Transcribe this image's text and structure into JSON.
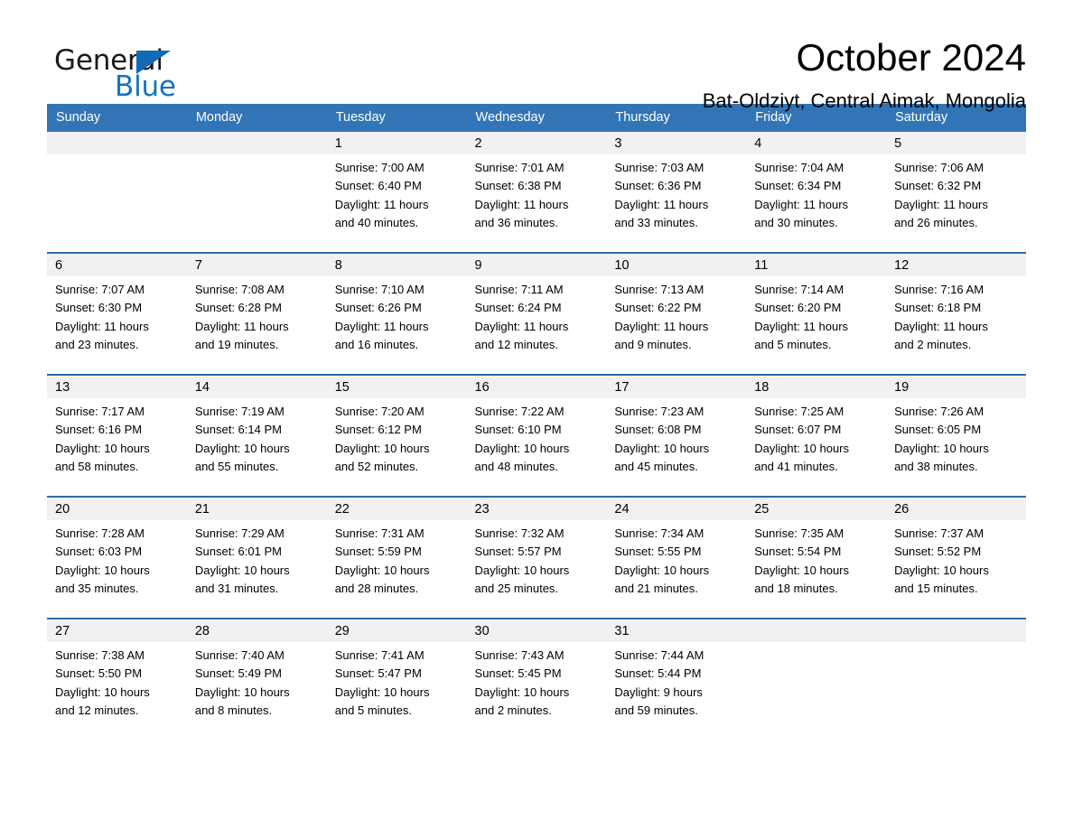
{
  "logo": {
    "word_one": "General",
    "word_two": "Blue",
    "triangle_color": "#106ab4",
    "blue_text_color": "#1673bd"
  },
  "header": {
    "month_title": "October 2024",
    "location": "Bat-Oldziyt, Central Aimak, Mongolia"
  },
  "theme": {
    "header_blue": "#3275b6",
    "row_border_blue": "#2d6da6",
    "daynum_band_gray": "#f1f1f1"
  },
  "weekday_headers": [
    "Sunday",
    "Monday",
    "Tuesday",
    "Wednesday",
    "Thursday",
    "Friday",
    "Saturday"
  ],
  "weeks": [
    [
      {
        "day": "",
        "lines": []
      },
      {
        "day": "",
        "lines": []
      },
      {
        "day": "1",
        "lines": [
          "Sunrise: 7:00 AM",
          "Sunset: 6:40 PM",
          "Daylight: 11 hours",
          "and 40 minutes."
        ]
      },
      {
        "day": "2",
        "lines": [
          "Sunrise: 7:01 AM",
          "Sunset: 6:38 PM",
          "Daylight: 11 hours",
          "and 36 minutes."
        ]
      },
      {
        "day": "3",
        "lines": [
          "Sunrise: 7:03 AM",
          "Sunset: 6:36 PM",
          "Daylight: 11 hours",
          "and 33 minutes."
        ]
      },
      {
        "day": "4",
        "lines": [
          "Sunrise: 7:04 AM",
          "Sunset: 6:34 PM",
          "Daylight: 11 hours",
          "and 30 minutes."
        ]
      },
      {
        "day": "5",
        "lines": [
          "Sunrise: 7:06 AM",
          "Sunset: 6:32 PM",
          "Daylight: 11 hours",
          "and 26 minutes."
        ]
      }
    ],
    [
      {
        "day": "6",
        "lines": [
          "Sunrise: 7:07 AM",
          "Sunset: 6:30 PM",
          "Daylight: 11 hours",
          "and 23 minutes."
        ]
      },
      {
        "day": "7",
        "lines": [
          "Sunrise: 7:08 AM",
          "Sunset: 6:28 PM",
          "Daylight: 11 hours",
          "and 19 minutes."
        ]
      },
      {
        "day": "8",
        "lines": [
          "Sunrise: 7:10 AM",
          "Sunset: 6:26 PM",
          "Daylight: 11 hours",
          "and 16 minutes."
        ]
      },
      {
        "day": "9",
        "lines": [
          "Sunrise: 7:11 AM",
          "Sunset: 6:24 PM",
          "Daylight: 11 hours",
          "and 12 minutes."
        ]
      },
      {
        "day": "10",
        "lines": [
          "Sunrise: 7:13 AM",
          "Sunset: 6:22 PM",
          "Daylight: 11 hours",
          "and 9 minutes."
        ]
      },
      {
        "day": "11",
        "lines": [
          "Sunrise: 7:14 AM",
          "Sunset: 6:20 PM",
          "Daylight: 11 hours",
          "and 5 minutes."
        ]
      },
      {
        "day": "12",
        "lines": [
          "Sunrise: 7:16 AM",
          "Sunset: 6:18 PM",
          "Daylight: 11 hours",
          "and 2 minutes."
        ]
      }
    ],
    [
      {
        "day": "13",
        "lines": [
          "Sunrise: 7:17 AM",
          "Sunset: 6:16 PM",
          "Daylight: 10 hours",
          "and 58 minutes."
        ]
      },
      {
        "day": "14",
        "lines": [
          "Sunrise: 7:19 AM",
          "Sunset: 6:14 PM",
          "Daylight: 10 hours",
          "and 55 minutes."
        ]
      },
      {
        "day": "15",
        "lines": [
          "Sunrise: 7:20 AM",
          "Sunset: 6:12 PM",
          "Daylight: 10 hours",
          "and 52 minutes."
        ]
      },
      {
        "day": "16",
        "lines": [
          "Sunrise: 7:22 AM",
          "Sunset: 6:10 PM",
          "Daylight: 10 hours",
          "and 48 minutes."
        ]
      },
      {
        "day": "17",
        "lines": [
          "Sunrise: 7:23 AM",
          "Sunset: 6:08 PM",
          "Daylight: 10 hours",
          "and 45 minutes."
        ]
      },
      {
        "day": "18",
        "lines": [
          "Sunrise: 7:25 AM",
          "Sunset: 6:07 PM",
          "Daylight: 10 hours",
          "and 41 minutes."
        ]
      },
      {
        "day": "19",
        "lines": [
          "Sunrise: 7:26 AM",
          "Sunset: 6:05 PM",
          "Daylight: 10 hours",
          "and 38 minutes."
        ]
      }
    ],
    [
      {
        "day": "20",
        "lines": [
          "Sunrise: 7:28 AM",
          "Sunset: 6:03 PM",
          "Daylight: 10 hours",
          "and 35 minutes."
        ]
      },
      {
        "day": "21",
        "lines": [
          "Sunrise: 7:29 AM",
          "Sunset: 6:01 PM",
          "Daylight: 10 hours",
          "and 31 minutes."
        ]
      },
      {
        "day": "22",
        "lines": [
          "Sunrise: 7:31 AM",
          "Sunset: 5:59 PM",
          "Daylight: 10 hours",
          "and 28 minutes."
        ]
      },
      {
        "day": "23",
        "lines": [
          "Sunrise: 7:32 AM",
          "Sunset: 5:57 PM",
          "Daylight: 10 hours",
          "and 25 minutes."
        ]
      },
      {
        "day": "24",
        "lines": [
          "Sunrise: 7:34 AM",
          "Sunset: 5:55 PM",
          "Daylight: 10 hours",
          "and 21 minutes."
        ]
      },
      {
        "day": "25",
        "lines": [
          "Sunrise: 7:35 AM",
          "Sunset: 5:54 PM",
          "Daylight: 10 hours",
          "and 18 minutes."
        ]
      },
      {
        "day": "26",
        "lines": [
          "Sunrise: 7:37 AM",
          "Sunset: 5:52 PM",
          "Daylight: 10 hours",
          "and 15 minutes."
        ]
      }
    ],
    [
      {
        "day": "27",
        "lines": [
          "Sunrise: 7:38 AM",
          "Sunset: 5:50 PM",
          "Daylight: 10 hours",
          "and 12 minutes."
        ]
      },
      {
        "day": "28",
        "lines": [
          "Sunrise: 7:40 AM",
          "Sunset: 5:49 PM",
          "Daylight: 10 hours",
          "and 8 minutes."
        ]
      },
      {
        "day": "29",
        "lines": [
          "Sunrise: 7:41 AM",
          "Sunset: 5:47 PM",
          "Daylight: 10 hours",
          "and 5 minutes."
        ]
      },
      {
        "day": "30",
        "lines": [
          "Sunrise: 7:43 AM",
          "Sunset: 5:45 PM",
          "Daylight: 10 hours",
          "and 2 minutes."
        ]
      },
      {
        "day": "31",
        "lines": [
          "Sunrise: 7:44 AM",
          "Sunset: 5:44 PM",
          "Daylight: 9 hours",
          "and 59 minutes."
        ]
      },
      {
        "day": "",
        "lines": []
      },
      {
        "day": "",
        "lines": []
      }
    ]
  ]
}
